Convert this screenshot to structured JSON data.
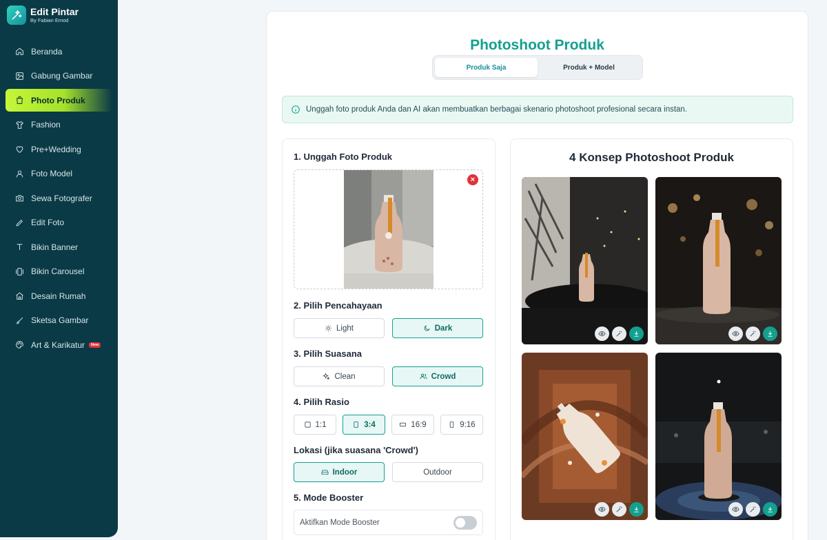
{
  "app": {
    "name": "Edit Pintar",
    "byline": "By Fabian Emod"
  },
  "sidebar": {
    "items": [
      {
        "label": "Beranda",
        "icon": "home-icon"
      },
      {
        "label": "Gabung Gambar",
        "icon": "image-icon"
      },
      {
        "label": "Photo Produk",
        "icon": "shopping-bag-icon",
        "active": true
      },
      {
        "label": "Fashion",
        "icon": "shirt-icon"
      },
      {
        "label": "Pre+Wedding",
        "icon": "heart-icon"
      },
      {
        "label": "Foto Model",
        "icon": "user-icon"
      },
      {
        "label": "Sewa Fotografer",
        "icon": "camera-icon"
      },
      {
        "label": "Edit Foto",
        "icon": "pencil-icon"
      },
      {
        "label": "Bikin Banner",
        "icon": "type-icon"
      },
      {
        "label": "Bikin Carousel",
        "icon": "carousel-icon"
      },
      {
        "label": "Desain Rumah",
        "icon": "house-icon"
      },
      {
        "label": "Sketsa Gambar",
        "icon": "brush-icon"
      },
      {
        "label": "Art & Karikatur",
        "icon": "palette-icon",
        "badge": "New"
      }
    ]
  },
  "main": {
    "title": "Photoshoot Produk",
    "tabs": [
      {
        "label": "Produk Saja",
        "active": true
      },
      {
        "label": "Produk + Model",
        "active": false
      }
    ],
    "info": "Unggah foto produk Anda dan AI akan membuatkan berbagai skenario photoshoot profesional secara instan."
  },
  "form": {
    "upload_title": "1. Unggah Foto Produk",
    "remove_label": "×",
    "lighting_title": "2. Pilih Pencahayaan",
    "lighting_options": [
      {
        "label": "Light"
      },
      {
        "label": "Dark",
        "selected": true
      }
    ],
    "ambience_title": "3. Pilih Suasana",
    "ambience_options": [
      {
        "label": "Clean"
      },
      {
        "label": "Crowd",
        "selected": true
      }
    ],
    "ratio_title": "4. Pilih Rasio",
    "ratio_options": [
      {
        "label": "1:1"
      },
      {
        "label": "3:4",
        "selected": true
      },
      {
        "label": "16:9"
      },
      {
        "label": "9:16"
      }
    ],
    "location_title": "Lokasi (jika suasana 'Crowd')",
    "location_options": [
      {
        "label": "Indoor",
        "selected": true
      },
      {
        "label": "Outdoor"
      }
    ],
    "booster_title": "5. Mode Booster",
    "booster_label": "Aktifkan Mode Booster",
    "booster_enabled": false
  },
  "results": {
    "title": "4 Konsep Photoshoot Produk",
    "actions": [
      "view-icon",
      "magic-wand-icon",
      "download-icon"
    ]
  },
  "colors": {
    "sidebar_bg": "#0a3a46",
    "accent": "#13a08f",
    "active_nav": "#c6f63a",
    "danger": "#e0323a"
  }
}
